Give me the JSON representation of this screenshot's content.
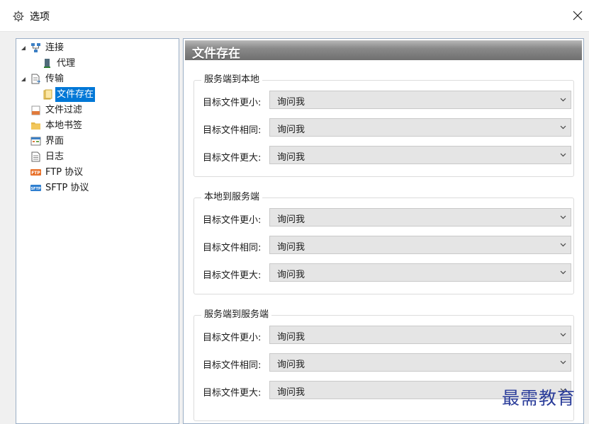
{
  "window": {
    "title": "选项",
    "title_icon": "gear-icon",
    "close_icon": "close-icon"
  },
  "tree": {
    "items": [
      {
        "label": "连接",
        "icon": "network-icon",
        "expanded": true
      },
      {
        "label": "代理",
        "icon": "proxy-icon"
      },
      {
        "label": "传输",
        "icon": "transfer-icon",
        "expanded": true
      },
      {
        "label": "文件存在",
        "icon": "file-exists-icon",
        "selected": true
      },
      {
        "label": "文件过滤",
        "icon": "file-filter-icon"
      },
      {
        "label": "本地书签",
        "icon": "folder-icon"
      },
      {
        "label": "界面",
        "icon": "interface-icon"
      },
      {
        "label": "日志",
        "icon": "log-icon"
      },
      {
        "label": "FTP 协议",
        "icon": "ftp-icon"
      },
      {
        "label": "SFTP 协议",
        "icon": "sftp-icon"
      }
    ]
  },
  "panel": {
    "title": "文件存在",
    "groups": [
      {
        "title": "服务端到本地",
        "rows": [
          {
            "label": "目标文件更小:",
            "value": "询问我"
          },
          {
            "label": "目标文件相同:",
            "value": "询问我"
          },
          {
            "label": "目标文件更大:",
            "value": "询问我"
          }
        ]
      },
      {
        "title": "本地到服务端",
        "rows": [
          {
            "label": "目标文件更小:",
            "value": "询问我"
          },
          {
            "label": "目标文件相同:",
            "value": "询问我"
          },
          {
            "label": "目标文件更大:",
            "value": "询问我"
          }
        ]
      },
      {
        "title": "服务端到服务端",
        "rows": [
          {
            "label": "目标文件更小:",
            "value": "询问我"
          },
          {
            "label": "目标文件相同:",
            "value": "询问我"
          },
          {
            "label": "目标文件更大:",
            "value": "询问我"
          }
        ]
      }
    ]
  },
  "watermark": "最需教育",
  "colors": {
    "selection": "#0078d7",
    "header_gradient_top": "#b9b9b9",
    "header_gradient_bottom": "#6f6f6f",
    "watermark": "#2b3d9a"
  }
}
